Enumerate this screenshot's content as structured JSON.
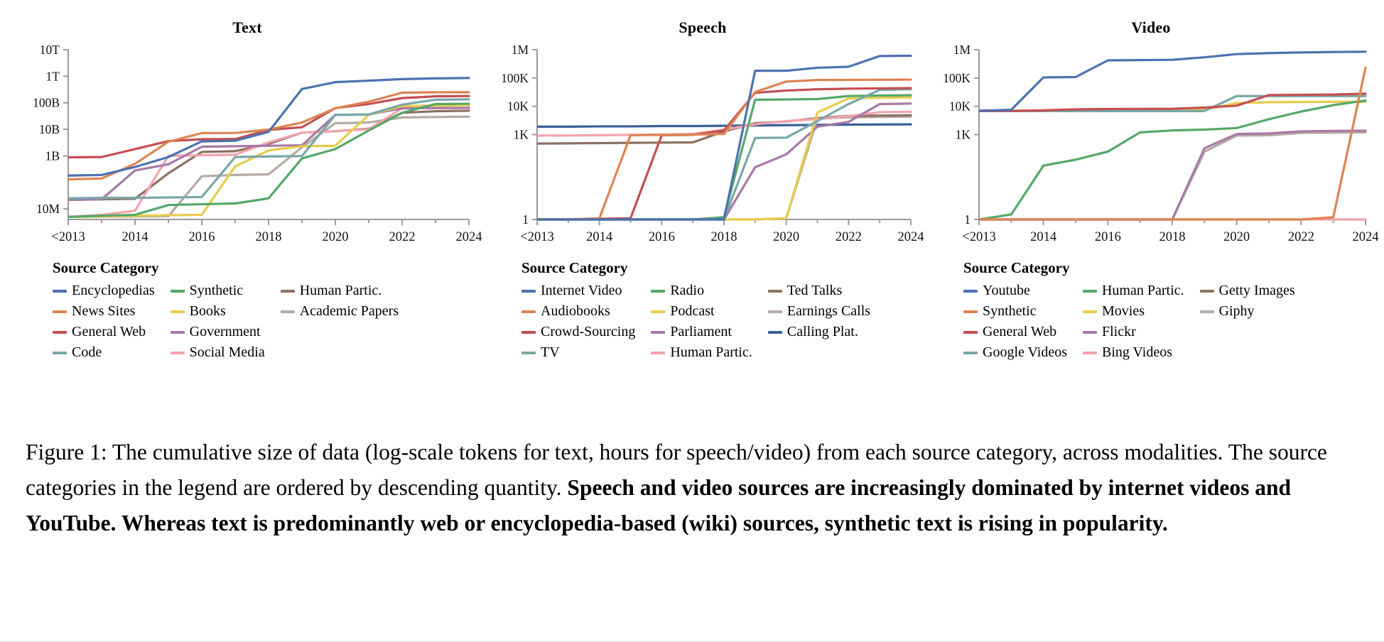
{
  "figure": {
    "caption_plain": "Figure 1: The cumulative size of data (log-scale tokens for text, hours for speech/video) from each source category, across modalities. The source categories in the legend are ordered by descending quantity. ",
    "caption_bold": "Speech and video sources are increasingly dominated by internet videos and YouTube. Whereas text is predominantly web or encyclopedia-based (wiki) sources, synthetic text is rising in popularity."
  },
  "legend_heading": "Source Category",
  "palette": {
    "blue": "#4c72b0",
    "orange": "#dd8452",
    "red": "#c44e52",
    "teal": "#78a7a8",
    "green": "#55a868",
    "yellow": "#e8cc4e",
    "purple": "#a779a8",
    "pink": "#f4a3ad",
    "brown": "#8c7161",
    "gray": "#b5aaa4",
    "navy": "#3b5f96"
  },
  "chart_data": [
    {
      "id": "text",
      "type": "line",
      "title": "Text",
      "xlabel": "",
      "ylabel": "",
      "yscale": "log",
      "grid": false,
      "legend_position": "below",
      "x": [
        "<2013",
        "2013",
        "2014",
        "2015",
        "2016",
        "2017",
        "2018",
        "2019",
        "2020",
        "2021",
        "2022",
        "2023",
        "2024"
      ],
      "xticks": [
        "<2013",
        "2014",
        "2016",
        "2018",
        "2020",
        "2022",
        "2024"
      ],
      "yticks": [
        "10T",
        "1T",
        "100B",
        "10B",
        "1B",
        "10M"
      ],
      "ytick_values": [
        10000000000000,
        1000000000000,
        100000000000,
        10000000000,
        1000000000,
        10000000
      ],
      "ylim": [
        4000000,
        10000000000000
      ],
      "series": [
        {
          "name": "Encyclopedias",
          "color": "#4c72b0",
          "values": [
            180000000,
            190000000,
            380000000,
            900000000,
            3500000000,
            3700000000,
            8000000000,
            330000000000,
            600000000000,
            680000000000,
            780000000000,
            830000000000,
            860000000000
          ]
        },
        {
          "name": "News Sites",
          "color": "#dd8452",
          "values": [
            130000000,
            140000000,
            500000000,
            3400000000,
            7200000000,
            7300000000,
            9800000000,
            18000000000,
            62000000000,
            110000000000,
            240000000000,
            250000000000,
            250000000000
          ]
        },
        {
          "name": "General Web",
          "color": "#c44e52",
          "values": [
            880000000,
            900000000,
            1800000000,
            3600000000,
            4200000000,
            4300000000,
            9500000000,
            12000000000,
            63000000000,
            90000000000,
            150000000000,
            175000000000,
            180000000000
          ]
        },
        {
          "name": "Code",
          "color": "#78a7a8",
          "values": [
            25000000,
            26000000,
            26000000,
            27000000,
            28000000,
            900000000,
            950000000,
            980000000,
            35000000000,
            36000000000,
            85000000000,
            130000000000,
            135000000000
          ]
        },
        {
          "name": "Synthetic",
          "color": "#55a868",
          "values": [
            5000000,
            5500000,
            6000000,
            14000000,
            15000000,
            16000000,
            25000000,
            800000000,
            1800000000,
            9000000000,
            42000000000,
            90000000000,
            92000000000
          ]
        },
        {
          "name": "Books",
          "color": "#e8cc4e",
          "values": [
            5000000,
            5200000,
            5500000,
            5800000,
            6000000,
            400000000,
            1600000000,
            2300000000,
            2400000000,
            35000000000,
            75000000000,
            78000000000,
            80000000000
          ]
        },
        {
          "name": "Government",
          "color": "#a779a8",
          "values": [
            22000000,
            23000000,
            280000000,
            480000000,
            2200000000,
            2300000000,
            2400000000,
            2500000000,
            35000000000,
            36000000000,
            62000000000,
            63000000000,
            64000000000
          ]
        },
        {
          "name": "Social Media",
          "color": "#f4a3ad",
          "values": [
            5000000,
            6000000,
            8500000,
            1000000000,
            1050000000,
            1100000000,
            3200000000,
            7500000000,
            8500000000,
            10000000000,
            62000000000,
            63000000000,
            63000000000
          ]
        },
        {
          "name": "Human Partic.",
          "color": "#8c7161",
          "values": [
            22000000,
            23000000,
            24000000,
            220000000,
            1400000000,
            1500000000,
            2800000000,
            7500000000,
            8500000000,
            10500000000,
            42000000000,
            48000000000,
            50000000000
          ]
        },
        {
          "name": "Academic Papers",
          "color": "#b5aaa4",
          "values": [
            5000000,
            5100000,
            5200000,
            5300000,
            170000000,
            190000000,
            200000000,
            2100000000,
            17000000000,
            18000000000,
            28000000000,
            29000000000,
            30000000000
          ]
        }
      ]
    },
    {
      "id": "speech",
      "type": "line",
      "title": "Speech",
      "xlabel": "",
      "ylabel": "",
      "yscale": "log",
      "grid": false,
      "legend_position": "below",
      "x": [
        "<2013",
        "2013",
        "2014",
        "2015",
        "2016",
        "2017",
        "2018",
        "2019",
        "2020",
        "2021",
        "2022",
        "2023",
        "2024"
      ],
      "xticks": [
        "<2013",
        "2014",
        "2016",
        "2018",
        "2020",
        "2022",
        "2024"
      ],
      "yticks": [
        "1M",
        "100K",
        "10K",
        "1K",
        "1"
      ],
      "ytick_values": [
        1000000,
        100000,
        10000,
        1000,
        1
      ],
      "ylim": [
        1,
        1000000
      ],
      "series": [
        {
          "name": "Internet Video",
          "color": "#4c72b0",
          "values": [
            1,
            1,
            1,
            1,
            1,
            1,
            1,
            180000,
            180000,
            230000,
            250000,
            600000,
            610000
          ]
        },
        {
          "name": "Audiobooks",
          "color": "#dd8452",
          "values": [
            1,
            1,
            1.1,
            950,
            980,
            1000,
            1050,
            32000,
            75000,
            85000,
            86000,
            87000,
            88000
          ]
        },
        {
          "name": "Crowd-Sourcing",
          "color": "#c44e52",
          "values": [
            1,
            1,
            1.05,
            1.1,
            950,
            980,
            1400,
            30000,
            36000,
            40000,
            42000,
            43000,
            44000
          ]
        },
        {
          "name": "TV",
          "color": "#78a7a8",
          "values": [
            1,
            1,
            1,
            1,
            1,
            1,
            1,
            760,
            780,
            3000,
            12000,
            38000,
            40000
          ]
        },
        {
          "name": "Radio",
          "color": "#55a868",
          "values": [
            1,
            1,
            1,
            1,
            1,
            1,
            1.2,
            17000,
            17500,
            18000,
            23000,
            24000,
            24500
          ]
        },
        {
          "name": "Podcast",
          "color": "#e8cc4e",
          "values": [
            1,
            1,
            1,
            1,
            1,
            1,
            1,
            1,
            1.1,
            6000,
            19000,
            20000,
            20500
          ]
        },
        {
          "name": "Parliament",
          "color": "#a779a8",
          "values": [
            1,
            1,
            1,
            1,
            1,
            1,
            1,
            70,
            200,
            1900,
            2800,
            12000,
            12500
          ]
        },
        {
          "name": "Human Partic.",
          "color": "#f4a3ad",
          "values": [
            920,
            930,
            950,
            980,
            1000,
            1050,
            1500,
            2300,
            3000,
            3500,
            4500,
            6200,
            6400
          ]
        },
        {
          "name": "Ted Talks",
          "color": "#8c7161",
          "values": [
            480,
            490,
            500,
            510,
            520,
            530,
            1300,
            2500,
            2900,
            3800,
            4600,
            4700,
            4800
          ]
        },
        {
          "name": "Earnings Calls",
          "color": "#b5aaa4",
          "values": [
            1,
            1,
            1,
            1,
            1,
            1,
            1,
            1,
            1.1,
            3700,
            4100,
            4200,
            4300
          ]
        },
        {
          "name": "Calling Plat.",
          "color": "#3b5f96",
          "values": [
            1900,
            1900,
            1950,
            1950,
            2000,
            2000,
            2050,
            2100,
            2150,
            2200,
            2250,
            2280,
            2300
          ]
        }
      ]
    },
    {
      "id": "video",
      "type": "line",
      "title": "Video",
      "xlabel": "",
      "ylabel": "",
      "yscale": "log",
      "grid": false,
      "legend_position": "below",
      "x": [
        "<2013",
        "2013",
        "2014",
        "2015",
        "2016",
        "2017",
        "2018",
        "2019",
        "2020",
        "2021",
        "2022",
        "2023",
        "2024"
      ],
      "xticks": [
        "<2013",
        "2014",
        "2016",
        "2018",
        "2020",
        "2022",
        "2024"
      ],
      "yticks": [
        "1M",
        "100K",
        "10K",
        "1K",
        "1"
      ],
      "ytick_values": [
        1000000,
        100000,
        10000,
        1000,
        1
      ],
      "ylim": [
        1,
        1000000
      ],
      "series": [
        {
          "name": "Youtube",
          "color": "#4c72b0",
          "values": [
            7000,
            7500,
            105000,
            108000,
            420000,
            430000,
            440000,
            540000,
            700000,
            760000,
            800000,
            830000,
            850000
          ]
        },
        {
          "name": "Synthetic",
          "color": "#dd8452",
          "values": [
            1,
            1,
            1,
            1,
            1,
            1,
            1,
            1,
            1,
            1,
            1,
            1.2,
            230000
          ]
        },
        {
          "name": "General Web",
          "color": "#c44e52",
          "values": [
            6800,
            6900,
            7200,
            7800,
            8000,
            8100,
            8200,
            9000,
            10500,
            25000,
            25500,
            26000,
            28000
          ]
        },
        {
          "name": "Google Videos",
          "color": "#78a7a8",
          "values": [
            6800,
            6800,
            6800,
            6800,
            6800,
            6800,
            6800,
            6800,
            23000,
            23000,
            23000,
            23000,
            23000
          ]
        },
        {
          "name": "Human Partic.",
          "color": "#55a868",
          "values": [
            1,
            1.5,
            80,
            130,
            250,
            1200,
            1400,
            1500,
            1700,
            3500,
            6500,
            11000,
            16000
          ]
        },
        {
          "name": "Movies",
          "color": "#e8cc4e",
          "values": [
            6900,
            6900,
            6900,
            7000,
            7100,
            7200,
            7300,
            7600,
            13000,
            14000,
            14200,
            14400,
            14500
          ]
        },
        {
          "name": "Flickr",
          "color": "#a779a8",
          "values": [
            1,
            1,
            1,
            1,
            1,
            1,
            1,
            330,
            1050,
            1100,
            1300,
            1350,
            1380
          ]
        },
        {
          "name": "Bing Videos",
          "color": "#f4a3ad",
          "values": [
            1,
            1,
            1,
            1,
            1,
            1,
            1,
            1,
            1,
            1,
            1,
            1,
            1
          ]
        },
        {
          "name": "Getty Images",
          "color": "#b5aaa4",
          "values": [
            1,
            1,
            1,
            1,
            1,
            1,
            1,
            250,
            920,
            950,
            1150,
            1180,
            1200
          ]
        },
        {
          "name": "Giphy",
          "color": "#b5aaa4",
          "values": [
            1,
            1,
            1,
            1,
            1,
            1,
            1,
            250,
            920,
            950,
            1150,
            1180,
            1200
          ]
        }
      ]
    }
  ],
  "legends": [
    {
      "id": "text",
      "title": "Source Category",
      "items": [
        {
          "label": "Encyclopedias",
          "color": "#4c72b0"
        },
        {
          "label": "News Sites",
          "color": "#dd8452"
        },
        {
          "label": "General Web",
          "color": "#c44e52"
        },
        {
          "label": "Code",
          "color": "#78a7a8"
        },
        {
          "label": "Synthetic",
          "color": "#55a868"
        },
        {
          "label": "Books",
          "color": "#e8cc4e"
        },
        {
          "label": "Government",
          "color": "#a779a8"
        },
        {
          "label": "Social Media",
          "color": "#f4a3ad"
        },
        {
          "label": "Human Partic.",
          "color": "#8c7161"
        },
        {
          "label": "Academic Papers",
          "color": "#b5aaa4"
        }
      ]
    },
    {
      "id": "speech",
      "title": "Source Category",
      "items": [
        {
          "label": "Internet Video",
          "color": "#4c72b0"
        },
        {
          "label": "Audiobooks",
          "color": "#dd8452"
        },
        {
          "label": "Crowd-Sourcing",
          "color": "#c44e52"
        },
        {
          "label": "TV",
          "color": "#78a7a8"
        },
        {
          "label": "Radio",
          "color": "#55a868"
        },
        {
          "label": "Podcast",
          "color": "#e8cc4e"
        },
        {
          "label": "Parliament",
          "color": "#a779a8"
        },
        {
          "label": "Human Partic.",
          "color": "#f4a3ad"
        },
        {
          "label": "Ted Talks",
          "color": "#8c7161"
        },
        {
          "label": "Earnings Calls",
          "color": "#b5aaa4"
        },
        {
          "label": "Calling Plat.",
          "color": "#3b5f96"
        }
      ]
    },
    {
      "id": "video",
      "title": "Source Category",
      "items": [
        {
          "label": "Youtube",
          "color": "#4c72b0"
        },
        {
          "label": "Synthetic",
          "color": "#dd8452"
        },
        {
          "label": "General Web",
          "color": "#c44e52"
        },
        {
          "label": "Google Videos",
          "color": "#78a7a8"
        },
        {
          "label": "Human Partic.",
          "color": "#55a868"
        },
        {
          "label": "Movies",
          "color": "#e8cc4e"
        },
        {
          "label": "Flickr",
          "color": "#a779a8"
        },
        {
          "label": "Bing Videos",
          "color": "#f4a3ad"
        },
        {
          "label": "Getty Images",
          "color": "#8c7161"
        },
        {
          "label": "Giphy",
          "color": "#b5aaa4"
        }
      ]
    }
  ]
}
